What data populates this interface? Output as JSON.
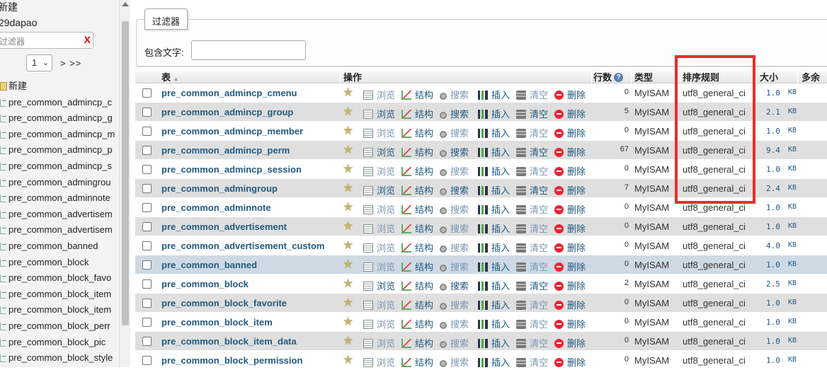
{
  "nav": {
    "top_new": "新建",
    "db_name": "29dapao",
    "filter_placeholder": "过滤器",
    "clear_icon": "X",
    "page_value": "1",
    "page_next": "> >>",
    "items": [
      {
        "label": "新建",
        "icon": "new-icon"
      },
      {
        "label": "pre_common_admincp_c",
        "icon": "table-icon"
      },
      {
        "label": "pre_common_admincp_g",
        "icon": "table-icon"
      },
      {
        "label": "pre_common_admincp_m",
        "icon": "table-icon"
      },
      {
        "label": "pre_common_admincp_p",
        "icon": "table-icon"
      },
      {
        "label": "pre_common_admincp_s",
        "icon": "table-icon"
      },
      {
        "label": "pre_common_admingrou",
        "icon": "table-icon"
      },
      {
        "label": "pre_common_adminnote",
        "icon": "table-icon"
      },
      {
        "label": "pre_common_advertisem",
        "icon": "table-icon"
      },
      {
        "label": "pre_common_advertisem",
        "icon": "table-icon"
      },
      {
        "label": "pre_common_banned",
        "icon": "table-icon"
      },
      {
        "label": "pre_common_block",
        "icon": "table-icon"
      },
      {
        "label": "pre_common_block_favo",
        "icon": "table-icon"
      },
      {
        "label": "pre_common_block_item",
        "icon": "table-icon"
      },
      {
        "label": "pre_common_block_item",
        "icon": "table-icon"
      },
      {
        "label": "pre_common_block_perr",
        "icon": "table-icon"
      },
      {
        "label": "pre_common_block_pic",
        "icon": "table-icon"
      },
      {
        "label": "pre_common_block_style",
        "icon": "table-icon"
      }
    ]
  },
  "filter": {
    "legend": "过滤器",
    "label": "包含文字:",
    "value": ""
  },
  "table": {
    "headers": {
      "table": "表",
      "sort_indicator": "▲",
      "actions": "操作",
      "rows": "行数",
      "help": "?",
      "type": "类型",
      "collation": "排序规则",
      "size": "大小",
      "overhead": "多余"
    },
    "action_labels": {
      "browse": "浏览",
      "structure": "结构",
      "search": "搜索",
      "insert": "插入",
      "empty": "清空",
      "drop": "删除"
    },
    "rows": [
      {
        "name": "pre_common_admincp_cmenu",
        "rows": "0",
        "engine": "MyISAM",
        "collation": "utf8_general_ci",
        "size": "1.0",
        "unit": "KB",
        "style": "odd",
        "browse_dim": true
      },
      {
        "name": "pre_common_admincp_group",
        "rows": "5",
        "engine": "MyISAM",
        "collation": "utf8_general_ci",
        "size": "2.1",
        "unit": "KB",
        "style": "even",
        "browse_dim": false
      },
      {
        "name": "pre_common_admincp_member",
        "rows": "0",
        "engine": "MyISAM",
        "collation": "utf8_general_ci",
        "size": "1.0",
        "unit": "KB",
        "style": "odd",
        "browse_dim": true
      },
      {
        "name": "pre_common_admincp_perm",
        "rows": "67",
        "engine": "MyISAM",
        "collation": "utf8_general_ci",
        "size": "9.4",
        "unit": "KB",
        "style": "even",
        "browse_dim": false
      },
      {
        "name": "pre_common_admincp_session",
        "rows": "0",
        "engine": "MyISAM",
        "collation": "utf8_general_ci",
        "size": "1.0",
        "unit": "KB",
        "style": "odd",
        "browse_dim": true
      },
      {
        "name": "pre_common_admingroup",
        "rows": "7",
        "engine": "MyISAM",
        "collation": "utf8_general_ci",
        "size": "2.4",
        "unit": "KB",
        "style": "even",
        "browse_dim": false
      },
      {
        "name": "pre_common_adminnote",
        "rows": "0",
        "engine": "MyISAM",
        "collation": "utf8_general_ci",
        "size": "1.0",
        "unit": "KB",
        "style": "odd",
        "browse_dim": true
      },
      {
        "name": "pre_common_advertisement",
        "rows": "0",
        "engine": "MyISAM",
        "collation": "utf8_general_ci",
        "size": "1.0",
        "unit": "KB",
        "style": "even",
        "browse_dim": true
      },
      {
        "name": "pre_common_advertisement_custom",
        "rows": "0",
        "engine": "MyISAM",
        "collation": "utf8_general_ci",
        "size": "4.0",
        "unit": "KB",
        "style": "odd",
        "browse_dim": true
      },
      {
        "name": "pre_common_banned",
        "rows": "0",
        "engine": "MyISAM",
        "collation": "utf8_general_ci",
        "size": "1.0",
        "unit": "KB",
        "style": "hl",
        "browse_dim": true
      },
      {
        "name": "pre_common_block",
        "rows": "2",
        "engine": "MyISAM",
        "collation": "utf8_general_ci",
        "size": "2.5",
        "unit": "KB",
        "style": "odd",
        "browse_dim": false
      },
      {
        "name": "pre_common_block_favorite",
        "rows": "0",
        "engine": "MyISAM",
        "collation": "utf8_general_ci",
        "size": "1.0",
        "unit": "KB",
        "style": "even",
        "browse_dim": true
      },
      {
        "name": "pre_common_block_item",
        "rows": "0",
        "engine": "MyISAM",
        "collation": "utf8_general_ci",
        "size": "1.0",
        "unit": "KB",
        "style": "odd",
        "browse_dim": true
      },
      {
        "name": "pre_common_block_item_data",
        "rows": "0",
        "engine": "MyISAM",
        "collation": "utf8_general_ci",
        "size": "1.0",
        "unit": "KB",
        "style": "even",
        "browse_dim": true
      },
      {
        "name": "pre_common_block_permission",
        "rows": "0",
        "engine": "MyISAM",
        "collation": "utf8_general_ci",
        "size": "1.0",
        "unit": "KB",
        "style": "odd",
        "browse_dim": true
      }
    ]
  },
  "colors": {
    "link": "#235a81",
    "highlight_box": "#e5302d",
    "row_even": "#dfdfdf",
    "row_selected": "#ced9e4"
  }
}
